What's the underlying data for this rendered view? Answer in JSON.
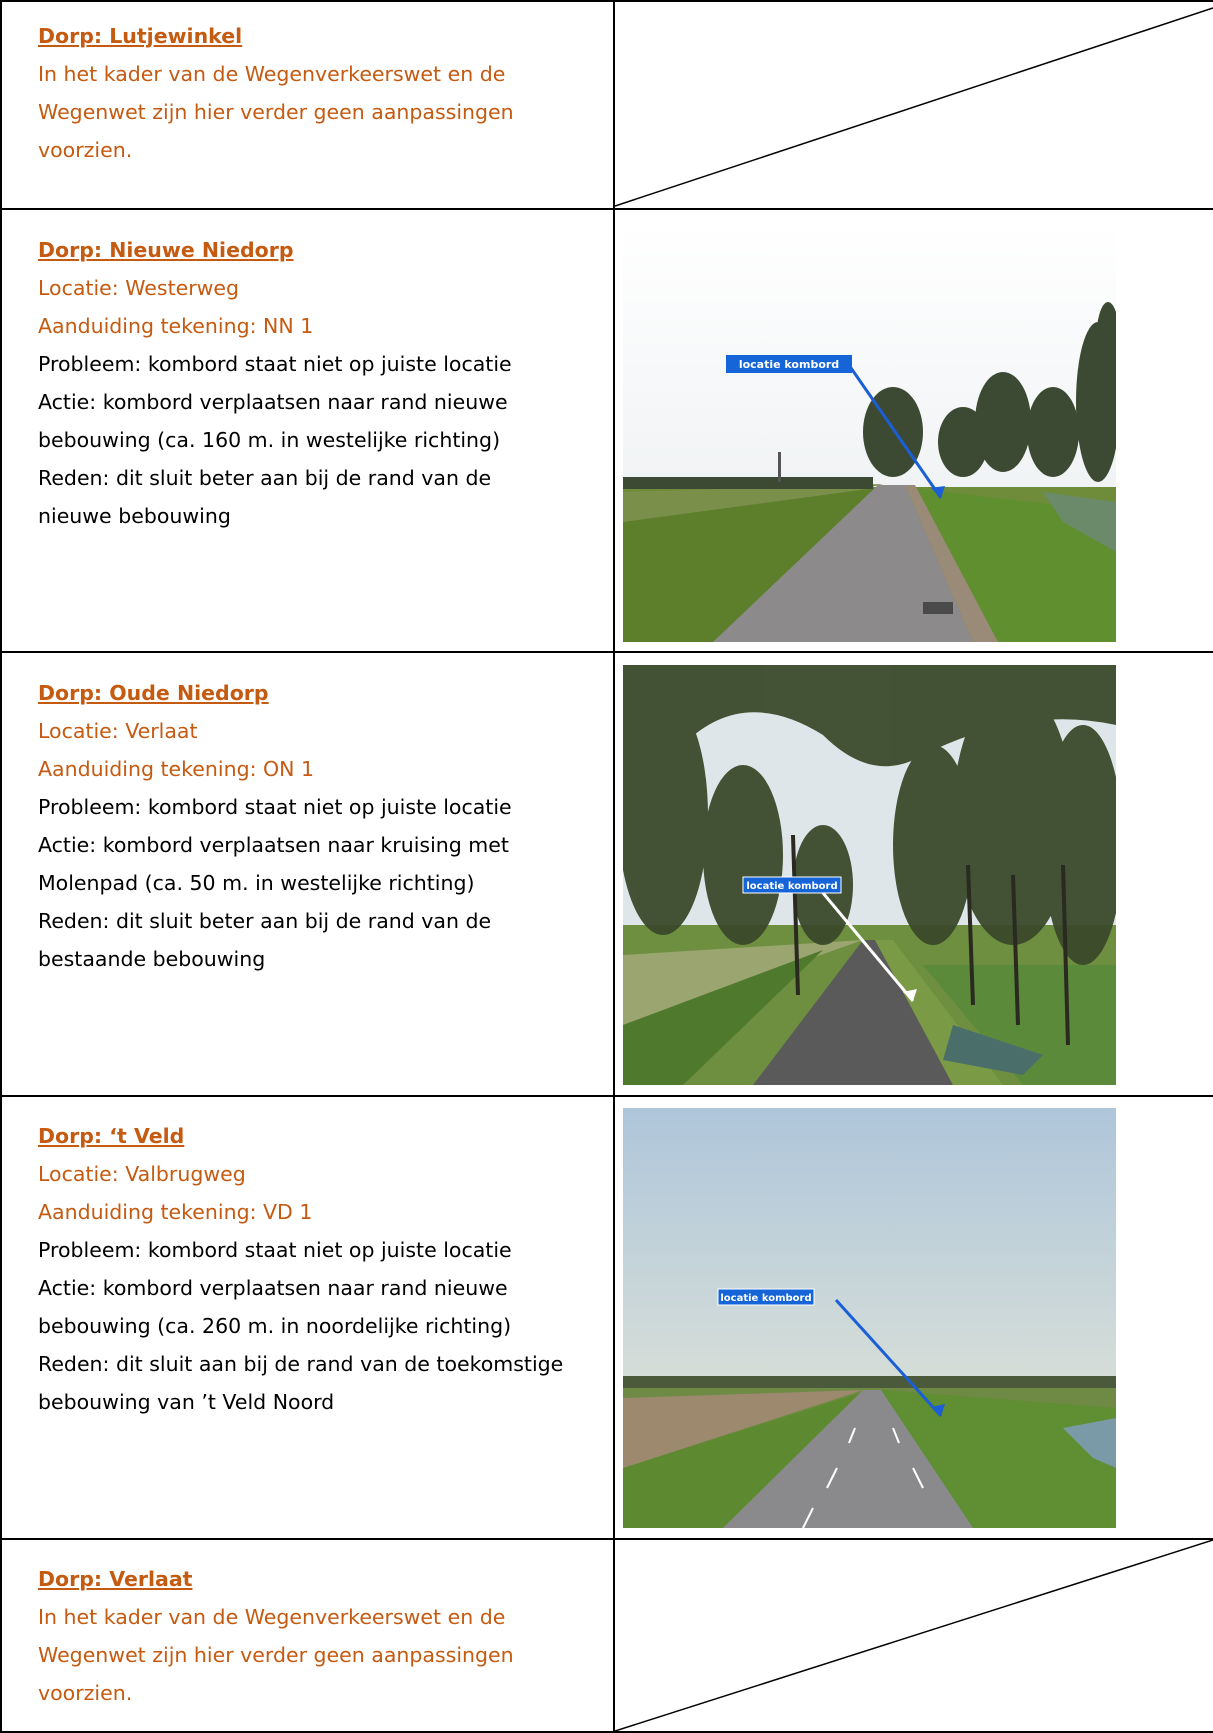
{
  "sections": [
    {
      "heading": "Dorp: Lutjewinkel",
      "intro": [
        "In het kader van de Wegenverkeerswet en de",
        "Wegenwet zijn hier verder geen aanpassingen",
        "voorzien."
      ]
    },
    {
      "heading": "Dorp: Nieuwe Niedorp",
      "location": "Locatie: Westerweg",
      "drawing": "Aanduiding tekening: NN 1",
      "lines": [
        "Probleem: kombord staat niet op juiste locatie",
        "Actie: kombord verplaatsen naar rand nieuwe",
        "bebouwing (ca. 160 m. in westelijke richting)",
        "Reden: dit sluit beter aan bij de rand van de",
        "nieuwe bebouwing"
      ],
      "photo_label": "locatie kombord"
    },
    {
      "heading": "Dorp: Oude Niedorp",
      "location": "Locatie: Verlaat",
      "drawing": "Aanduiding tekening: ON 1",
      "lines": [
        "Probleem: kombord staat niet op juiste locatie",
        "Actie: kombord verplaatsen naar kruising met",
        "Molenpad (ca. 50 m. in westelijke richting)",
        "Reden: dit sluit beter aan bij de rand van de",
        "bestaande bebouwing"
      ],
      "photo_label": "locatie kombord"
    },
    {
      "heading": "Dorp: ‘t Veld",
      "location": "Locatie: Valbrugweg",
      "drawing": "Aanduiding tekening: VD 1",
      "lines": [
        "Probleem: kombord staat niet op juiste locatie",
        "Actie: kombord verplaatsen naar rand nieuwe",
        "bebouwing (ca. 260 m. in noordelijke richting)",
        "Reden: dit sluit aan bij de rand van de toekomstige",
        "bebouwing van ’t Veld Noord"
      ],
      "photo_label": "locatie kombord"
    },
    {
      "heading": "Dorp: Verlaat",
      "intro": [
        "In het kader van de Wegenverkeerswet en de",
        "Wegenwet zijn hier verder geen aanpassingen",
        "voorzien."
      ]
    }
  ],
  "colors": {
    "accent": "#c55a11",
    "label_bg": "#1565d8"
  }
}
